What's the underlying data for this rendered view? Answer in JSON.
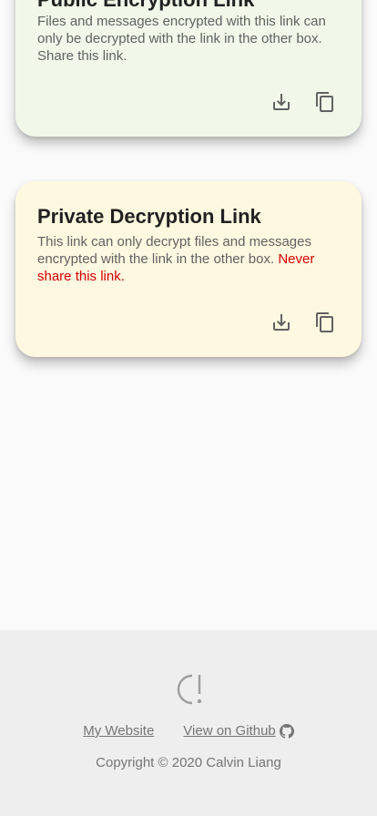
{
  "public_card": {
    "title": "Public Encryption Link",
    "description": "Files and messages encrypted with this link can only be decrypted with the link in the other box. Share this link.",
    "bg_color": "#f1f8e9"
  },
  "private_card": {
    "title": "Private Decryption Link",
    "description": "This link can only decrypt files and messages encrypted with the link in the other box. ",
    "warning": "Never share this link.",
    "bg_color": "#fff8e1",
    "warning_color": "#d50000"
  },
  "icons": {
    "download": "download-icon",
    "copy": "copy-icon",
    "github": "github-icon",
    "logo": "logo-icon"
  },
  "footer": {
    "my_website": "My Website",
    "view_on_github": "View on Github",
    "copyright": "Copyright © 2020 Calvin Liang"
  }
}
